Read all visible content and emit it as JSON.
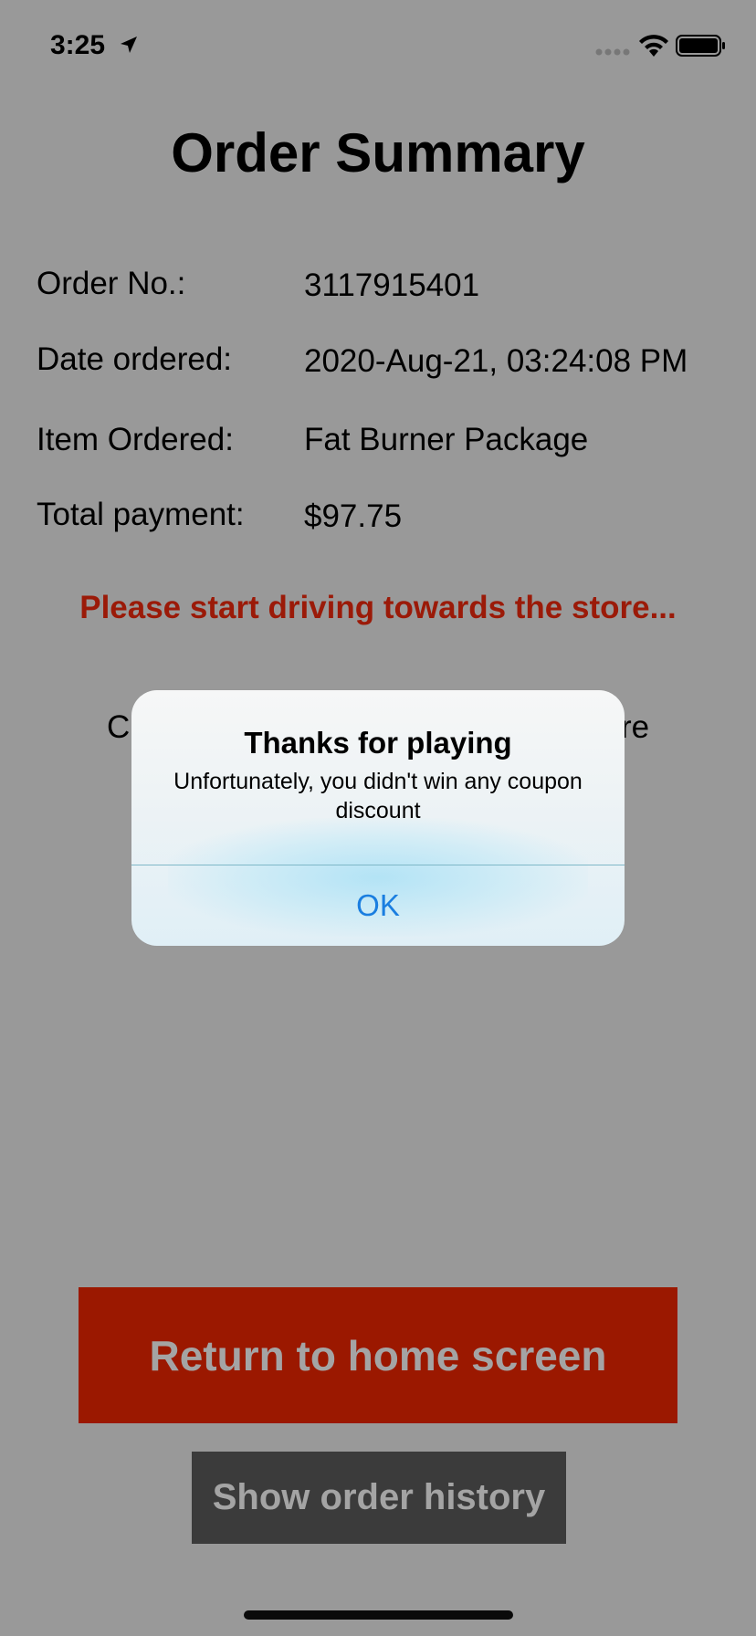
{
  "status_bar": {
    "time": "3:25",
    "icons": [
      "location-arrow-icon",
      "cellular-signal-icon",
      "wifi-icon",
      "battery-icon"
    ]
  },
  "title": "Order Summary",
  "order": {
    "rows": [
      {
        "label": "Order No.:",
        "value": "3117915401"
      },
      {
        "label": "Date ordered:",
        "value": "2020-Aug-21, 03:24:08 PM"
      },
      {
        "label": "Item Ordered:",
        "value": "Fat Burner Package"
      },
      {
        "label": "Total payment:",
        "value": "$97.75"
      }
    ]
  },
  "notice": "Please start driving towards the store...",
  "partially_hidden_text": {
    "left": "C",
    "right": "re"
  },
  "alert": {
    "title": "Thanks for playing",
    "message": "Unfortunately, you didn't win any coupon discount",
    "ok_label": "OK"
  },
  "buttons": {
    "home": "Return to home screen",
    "history": "Show order history"
  },
  "colors": {
    "background_dimmed": "#999999",
    "notice_red": "#9b1a08",
    "home_button": "#9b1800",
    "history_button": "#3b3b3b",
    "alert_link": "#1a7ee0"
  }
}
